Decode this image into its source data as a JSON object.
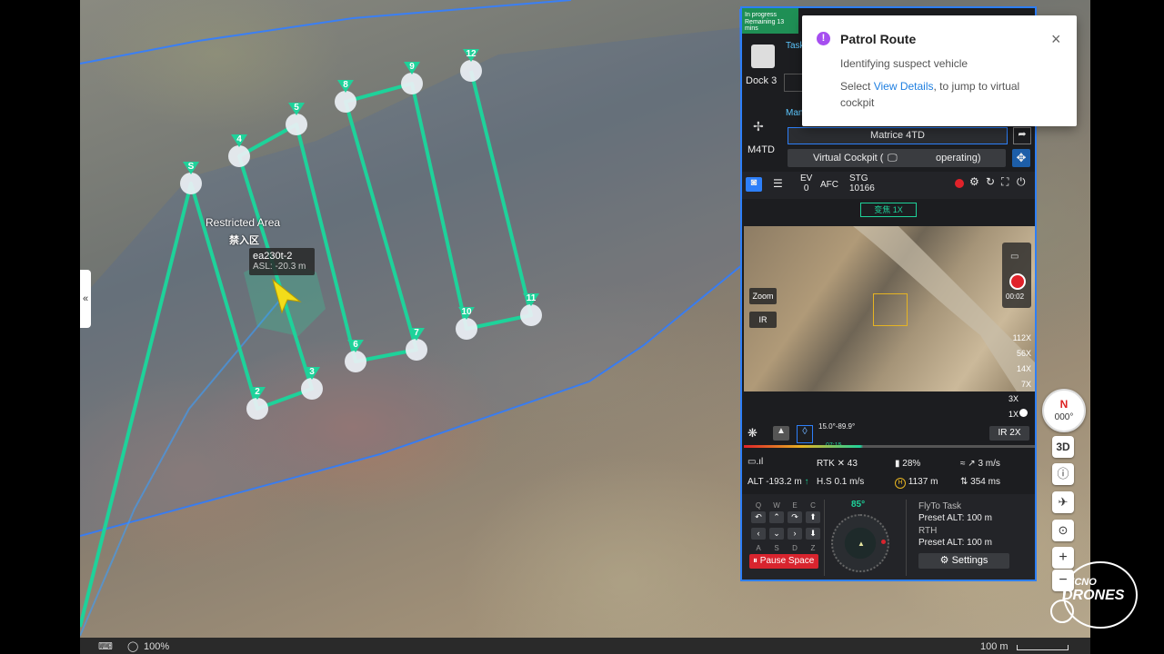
{
  "map": {
    "restricted_label": "Restricted Area",
    "restricted_label_cn": "禁入区",
    "vehicle_label": "ea230t-2",
    "vehicle_asl": "ASL: -20.3 m",
    "waypoints": [
      "S",
      "2",
      "3",
      "4",
      "5",
      "6",
      "7",
      "8",
      "9",
      "10",
      "11",
      "12"
    ],
    "zoom_percent": "100%",
    "scale": "100 m",
    "compass_dir": "N",
    "compass_heading": "000°",
    "btn_3d": "3D",
    "btn_zoom_in": "+",
    "btn_zoom_out": "−",
    "collapse_icon": "«"
  },
  "panel": {
    "status": "In progress",
    "remaining": "Remaining 13 mins",
    "task_label": "Task",
    "dock_label": "Dock 3",
    "aircraft_label": "M4TD",
    "mode_label": "Man",
    "aircraft_model": "Matrice 4TD",
    "virtual_cockpit": "Virtual Cockpit (",
    "operating": "operating)",
    "ev_label": "EV",
    "ev_value": "0",
    "afc": "AFC",
    "stg_label": "STG",
    "stg_value": "10166",
    "lens_mode": "变焦 1X",
    "zoom_btn": "Zoom",
    "ir_btn": "IR",
    "rec_time": "00:02",
    "zoom_levels": [
      "112X",
      "56X",
      "14X",
      "7X",
      "3X",
      "1X"
    ],
    "gimbal_angles": "15.0°-89.9°",
    "gimbal_time": "07:15",
    "ir_zoom": "IR 2X",
    "rtk_label": "RTK",
    "rtk_value": "43",
    "battery": "28%",
    "wind_speed": "3 m/s",
    "alt": "ALT -193.2 m",
    "hs": "H.S 0.1 m/s",
    "home_dist": "1137 m",
    "latency": "354 ms",
    "heading": "85°",
    "keys_row1": [
      "Q",
      "W",
      "E",
      "C"
    ],
    "keys_row2": [
      "A",
      "S",
      "D",
      "Z"
    ],
    "pause_btn": "Pause Space",
    "flyto_label": "FlyTo Task",
    "flyto_alt": "Preset ALT: 100 m",
    "rth_label": "RTH",
    "rth_alt": "Preset ALT: 100 m",
    "settings_btn": "Settings"
  },
  "toast": {
    "title": "Patrol Route",
    "line1": "Identifying suspect vehicle",
    "line2_pre": "Select",
    "line2_link": "View Details",
    "line2_post": ", to jump to virtual",
    "line3": "cockpit",
    "close": "×"
  },
  "colors": {
    "route": "#1ed29a",
    "panel_border": "#2d7ff9",
    "link": "#1f7fe0",
    "toast_icon": "#a64ef0",
    "record": "#e0222a"
  },
  "watermark": {
    "text1": "ECNO",
    "text2": "DRONES"
  }
}
